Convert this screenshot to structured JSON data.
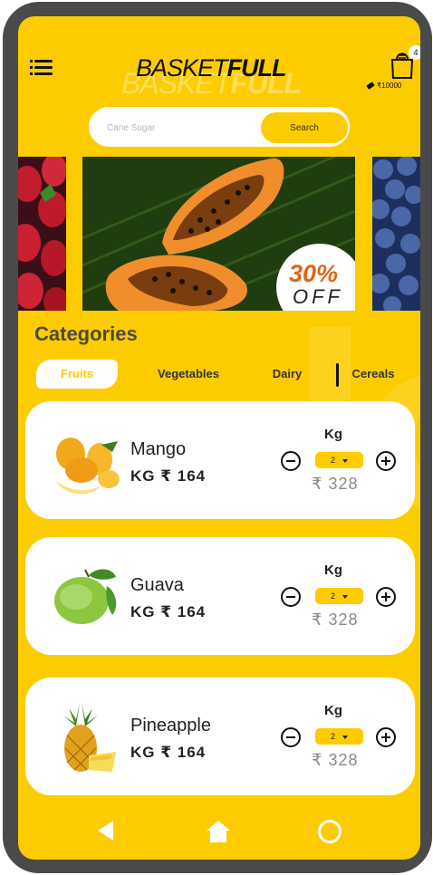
{
  "header": {
    "logo_thin": "BASKET",
    "logo_bold": "FULL",
    "cart_count": "4",
    "wallet_balance": "₹10000"
  },
  "search": {
    "placeholder": "Cane Sugar",
    "button_label": "Search"
  },
  "promo": {
    "percent": "30%",
    "off": "OFF"
  },
  "categories": {
    "title": "Categories",
    "tabs": [
      "Fruits",
      "Vegetables",
      "Dairy",
      "Cereals"
    ],
    "active": "Fruits"
  },
  "products": [
    {
      "name": "Mango",
      "price": "KG ₹ 164",
      "unit": "Kg",
      "qty": "2",
      "total": "₹ 328"
    },
    {
      "name": "Guava",
      "price": "KG ₹ 164",
      "unit": "Kg",
      "qty": "2",
      "total": "₹ 328"
    },
    {
      "name": "Pineapple",
      "price": "KG ₹ 164",
      "unit": "Kg",
      "qty": "2",
      "total": "₹ 328"
    }
  ],
  "colors": {
    "accent": "#fdcc00",
    "promo": "#e06413",
    "frame": "#4a4a4a"
  },
  "icons": [
    "menu-icon",
    "cart-icon",
    "wallet-icon",
    "back-icon",
    "home-icon",
    "recent-apps-icon",
    "minus-icon",
    "plus-icon",
    "dropdown-icon"
  ]
}
